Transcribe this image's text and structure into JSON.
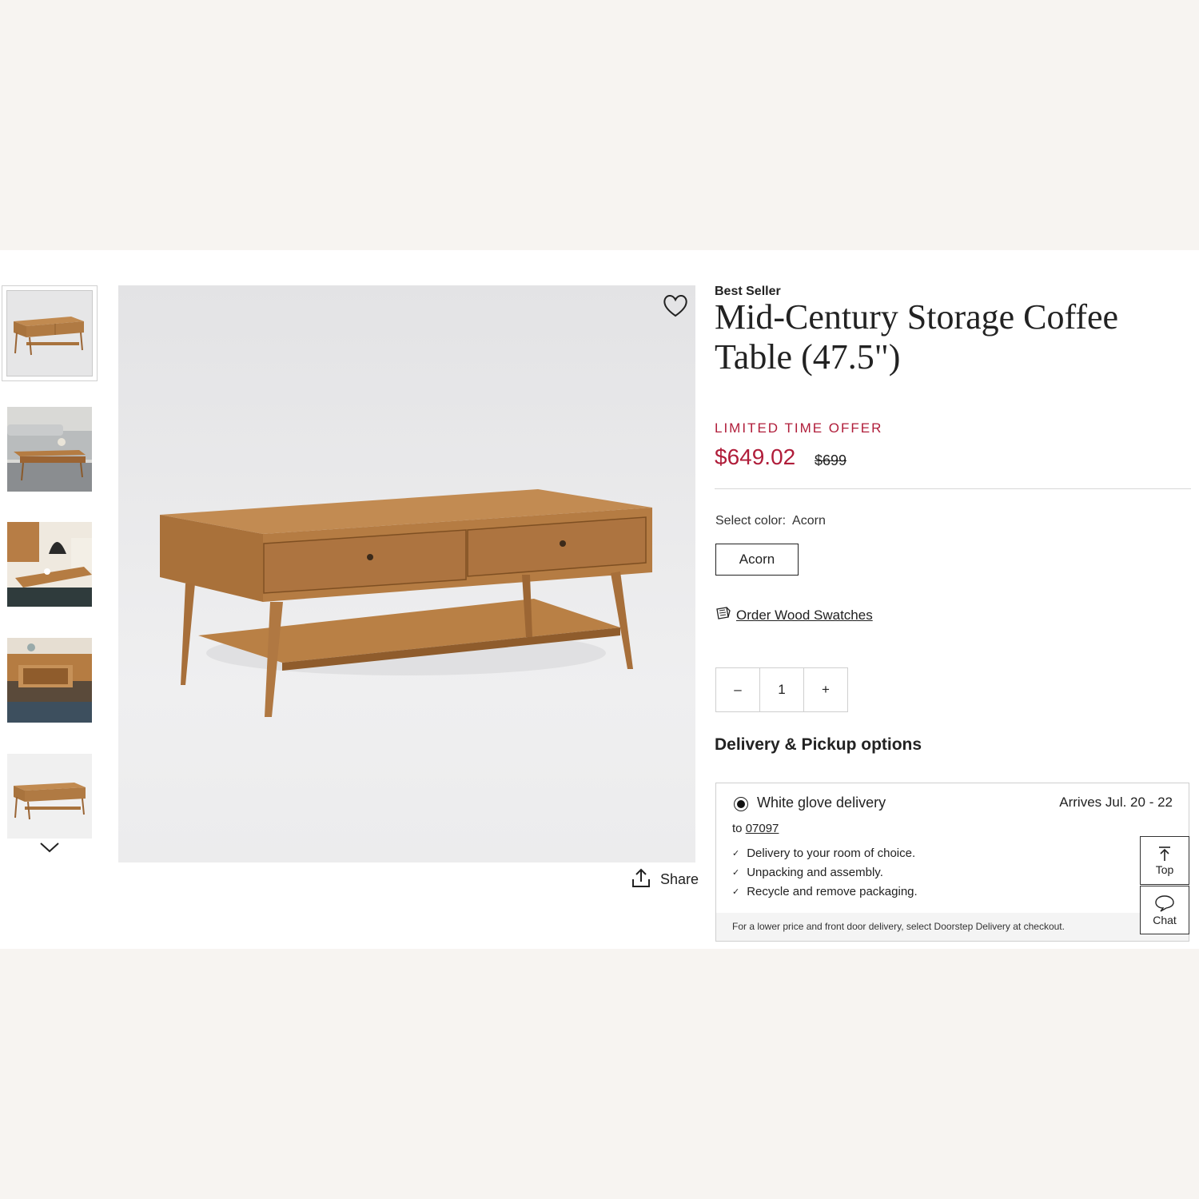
{
  "product": {
    "badge": "Best Seller",
    "title": "Mid-Century Storage Coffee Table (47.5\")",
    "offer_label": "LIMITED TIME OFFER",
    "price": "$649.02",
    "original_price": "$699",
    "wishlist_icon": "heart-icon"
  },
  "gallery": {
    "thumbnail_count": 5,
    "selected_index": 0,
    "scroll_icon": "chevron-down-icon",
    "share_label": "Share",
    "share_icon": "share-icon"
  },
  "color": {
    "select_label": "Select color:",
    "selected_value": "Acorn",
    "options": [
      "Acorn"
    ]
  },
  "swatches": {
    "label": "Order Wood Swatches",
    "icon": "swatch-icon"
  },
  "quantity": {
    "minus": "–",
    "value": "1",
    "plus": "+"
  },
  "delivery": {
    "heading": "Delivery & Pickup options",
    "option_label": "White glove delivery",
    "arrives": "Arrives Jul. 20 - 22",
    "to_label": "to",
    "zip": "07097",
    "features": [
      "Delivery to your room of choice.",
      "Unpacking and assembly.",
      "Recycle and remove packaging."
    ],
    "note": "For a lower price and front door delivery, select Doorstep Delivery at checkout."
  },
  "floating": {
    "top_label": "Top",
    "chat_label": "Chat",
    "top_icon": "arrow-up-icon",
    "chat_icon": "chat-icon"
  },
  "colors": {
    "sale_red": "#b01d3a",
    "wood": "#b07a43",
    "page_bg": "#f7f4f1"
  }
}
